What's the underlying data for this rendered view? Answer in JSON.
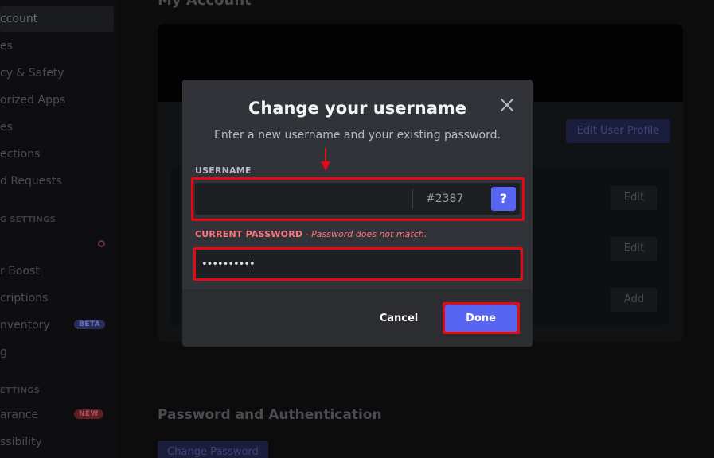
{
  "sidebar": {
    "items": [
      {
        "label": "ccount"
      },
      {
        "label": "es"
      },
      {
        "label": "cy & Safety"
      },
      {
        "label": "orized Apps"
      },
      {
        "label": "es"
      },
      {
        "label": "ections"
      },
      {
        "label": "d Requests"
      }
    ],
    "section_billing": "G SETTINGS",
    "billing_items": [
      {
        "label": "r Boost"
      },
      {
        "label": "criptions"
      },
      {
        "label": "nventory"
      },
      {
        "label": "g"
      }
    ],
    "beta_badge": "BETA",
    "section_app": "ETTINGS",
    "app_items": [
      {
        "label": "arance"
      },
      {
        "label": "ssibility"
      }
    ],
    "new_badge": "NEW"
  },
  "background": {
    "title": "My Account",
    "edit_profile": "Edit User Profile",
    "edit_1": "Edit",
    "edit_2": "Edit",
    "add": "Add",
    "password_heading": "Password and Authentication",
    "change_password": "Change Password"
  },
  "modal": {
    "title": "Change your username",
    "subtitle": "Enter a new username and your existing password.",
    "username_label": "USERNAME",
    "username_value": "",
    "discriminator": "#2387",
    "help_label": "?",
    "password_label": "CURRENT PASSWORD",
    "password_error": " - Password does not match.",
    "password_value": "••••••••••",
    "cancel_label": "Cancel",
    "done_label": "Done"
  },
  "colors": {
    "brand": "#5865f2",
    "error": "#fa777c",
    "highlight": "#e50914",
    "modal_bg": "#313338",
    "footer_bg": "#2b2d31"
  }
}
